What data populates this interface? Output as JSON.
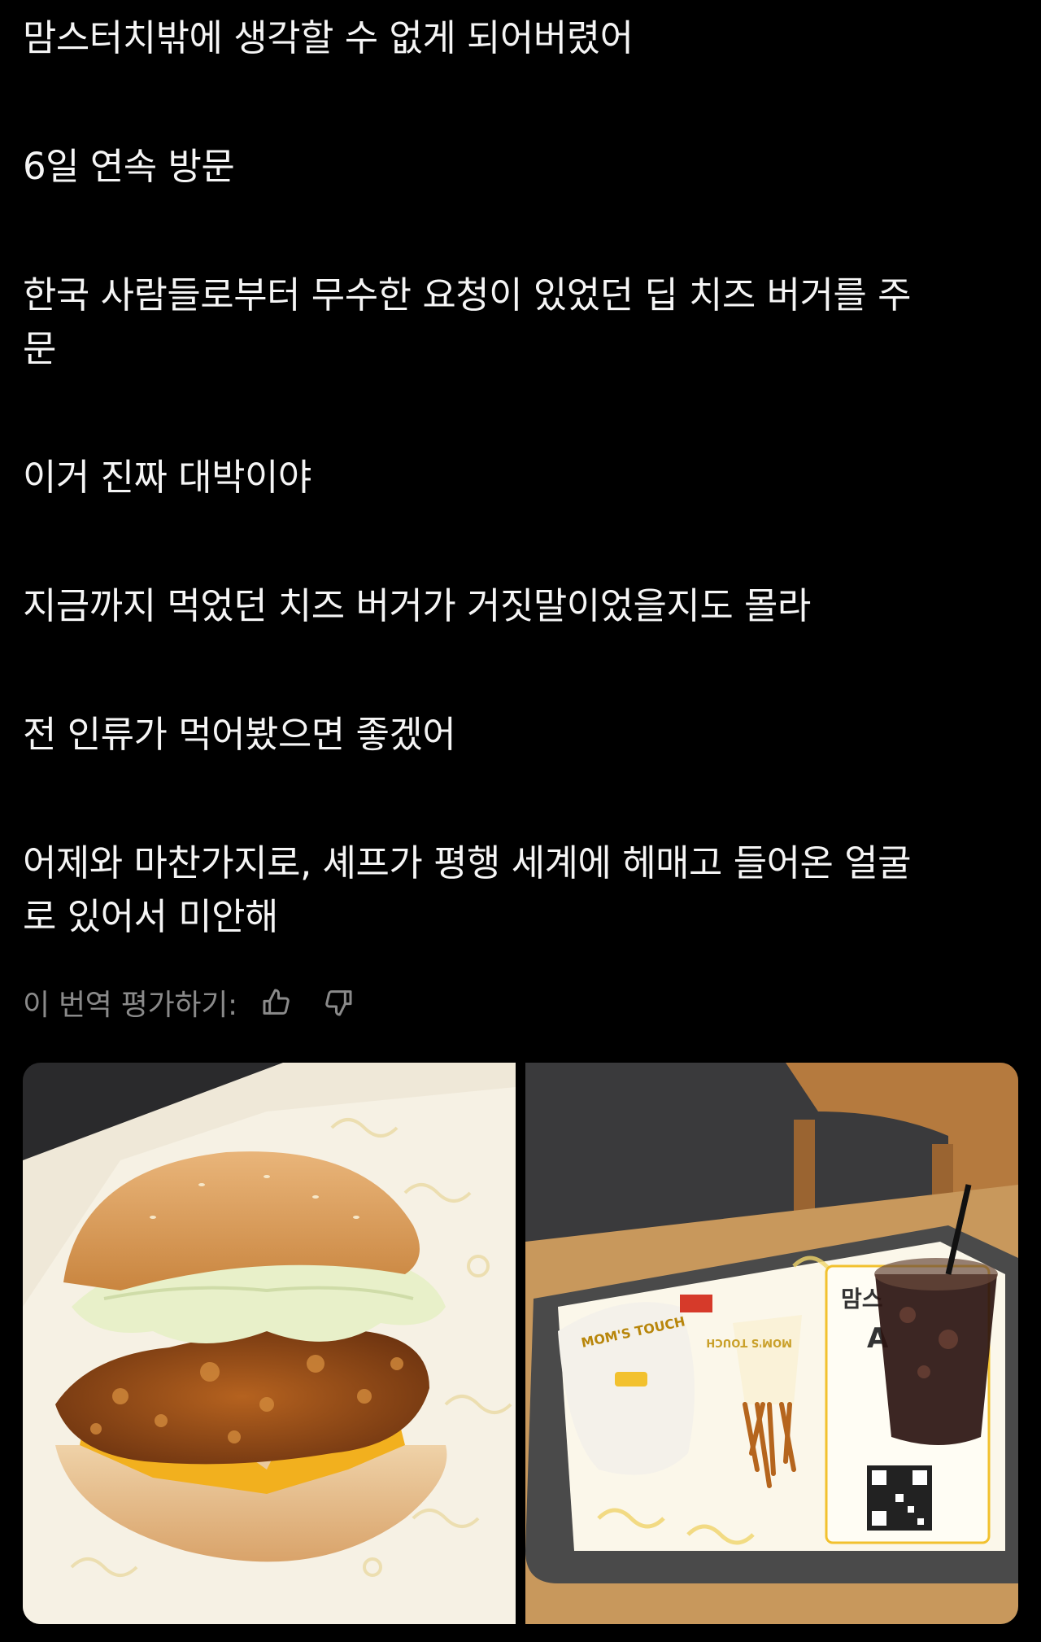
{
  "post": {
    "paragraphs": [
      "맘스터치밖에 생각할 수 없게 되어버렸어",
      "6일 연속 방문",
      "한국 사람들로부터 무수한 요청이 있었던 딥 치즈 버거를 주\n문",
      "이거 진짜 대박이야",
      "지금까지 먹었던 치즈 버거가 거짓말이었을지도 몰라",
      "전 인류가 먹어봤으면 좋겠어",
      "어제와 마찬가지로, 셰프가 평행 세계에 헤매고 들어온 얼굴\n로 있어서 미안해"
    ]
  },
  "translation_rating": {
    "label": "이 번역 평가하기:",
    "thumbs_up_icon": "thumbs-up-icon",
    "thumbs_down_icon": "thumbs-down-icon"
  },
  "media": {
    "images": [
      {
        "subject": "burger",
        "wrapper_text": ""
      },
      {
        "subject": "tray",
        "bag_text": "MOM'S TOUCH",
        "sleeve_text": "MOM'S TOUCH",
        "placemat_text": "맘스\nA"
      }
    ]
  },
  "colors": {
    "background": "#000000",
    "text": "#f5f5f5",
    "muted": "#8a8a8a"
  }
}
